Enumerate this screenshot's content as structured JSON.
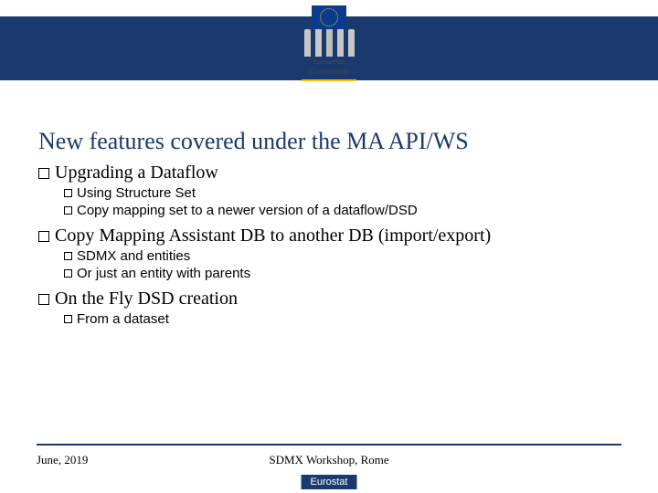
{
  "logo": {
    "line1": "European",
    "line2": "Commission"
  },
  "title": "New features covered under the MA API/WS",
  "bullets": [
    {
      "text": "Upgrading a Dataflow",
      "children": [
        {
          "text": "Using Structure Set"
        },
        {
          "text": "Copy mapping set to a newer version of a dataflow/DSD"
        }
      ]
    },
    {
      "text": "Copy Mapping Assistant DB to another DB (import/export)",
      "children": [
        {
          "text": "SDMX and entities"
        },
        {
          "text": "Or just an entity with parents"
        }
      ]
    },
    {
      "text": "On the Fly DSD creation",
      "children": [
        {
          "text": "From a dataset"
        }
      ]
    }
  ],
  "footer": {
    "left": "June, 2019",
    "center": "SDMX Workshop, Rome",
    "badge": "Eurostat"
  }
}
